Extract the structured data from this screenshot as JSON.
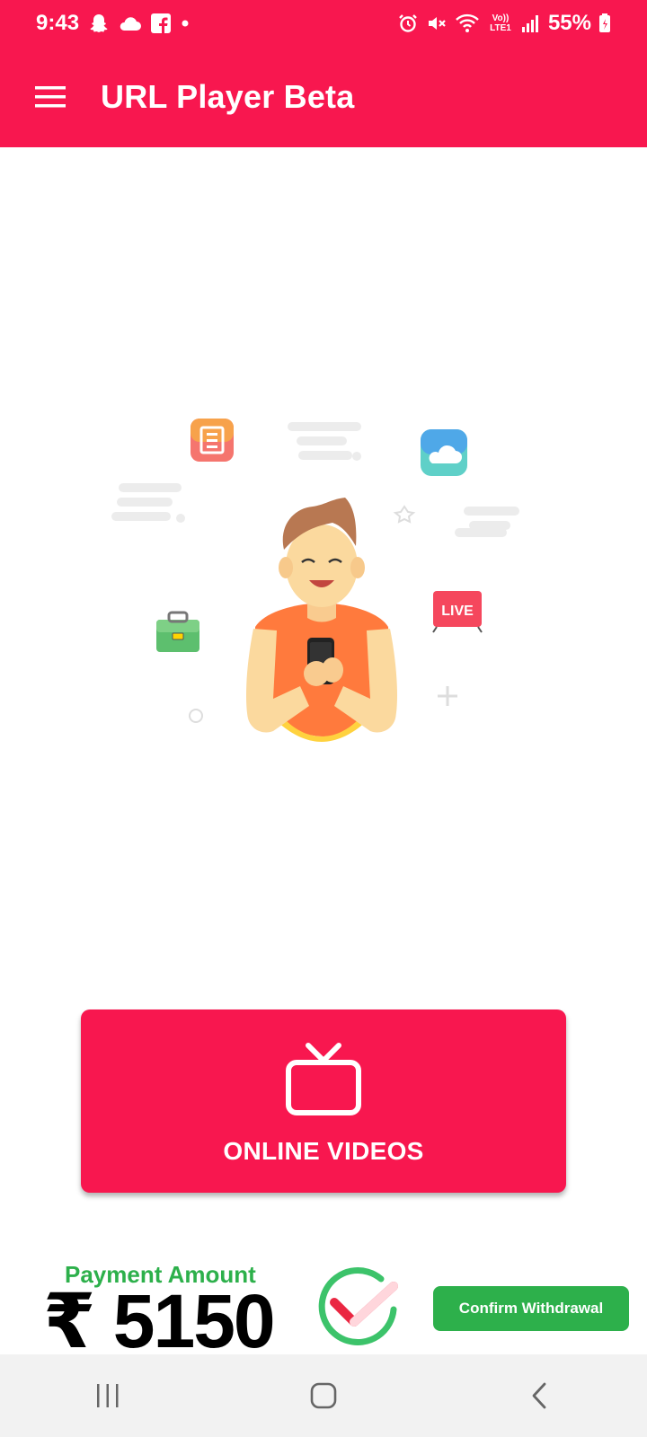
{
  "status_bar": {
    "time": "9:43",
    "battery": "55%",
    "network": "Vo)) LTE1"
  },
  "app_bar": {
    "title": "URL Player Beta",
    "menu_icon": "hamburger-menu-icon"
  },
  "illustration": {
    "live_badge": "LIVE",
    "icons": [
      "news-icon",
      "cloud-icon",
      "briefcase-icon",
      "live-tv-icon"
    ]
  },
  "main": {
    "online_button_label": "ONLINE VIDEOS",
    "online_button_icon": "tv-icon"
  },
  "ad": {
    "label": "Payment Amount",
    "amount": "₹ 5150",
    "cta": "Confirm Withdrawal"
  },
  "colors": {
    "primary": "#F8174F",
    "ad_green": "#2DB04B",
    "nav_background": "#F2F2F2"
  },
  "nav_bar": {
    "icons": [
      "recent-apps-icon",
      "home-icon",
      "back-icon"
    ]
  }
}
